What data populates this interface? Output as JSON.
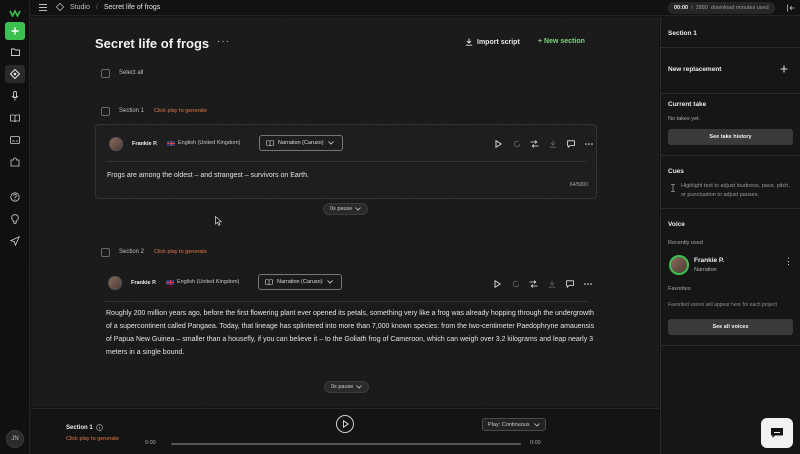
{
  "breadcrumb": {
    "app": "Studio",
    "project": "Secret life of frogs"
  },
  "usage": {
    "used": "00:00",
    "total": "2880",
    "suffix": "download minutes used"
  },
  "rail": {
    "user_initials": "JN"
  },
  "project": {
    "title": "Secret life of frogs",
    "import_label": "Import script",
    "new_section_label": "+ New section",
    "select_all_label": "Select all"
  },
  "sections": [
    {
      "label": "Section 1",
      "status": "Click play to generate",
      "voice": "Frankie P.",
      "language": "English (United Kingdom)",
      "model": "Narration (Caruso)",
      "text": "Frogs are among the oldest – and strangest – survivors on Earth.",
      "char_count": "64/5000",
      "pause": "0s pause"
    },
    {
      "label": "Section 2",
      "status": "Click play to generate",
      "voice": "Frankie P.",
      "language": "English (United Kingdom)",
      "model": "Narration (Caruso)",
      "text": "Roughly 200 million years ago, before the first flowering plant ever opened its petals, something very like a frog was already hopping through the undergrowth of a supercontinent called Pangaea. Today, that lineage has splintered into more than 7,000 known species: from the two-centimeter Paedophryne amauensis of Papua New Guinea – smaller than a housefly, if you can believe it – to the Goliath frog of Cameroon, which can weigh over 3.2 kilograms and leap nearly 3 meters in a single bound.",
      "pause": "0s pause"
    }
  ],
  "player": {
    "section": "Section 1",
    "status": "Click play to generate",
    "mode": "Play: Continuous",
    "time_start": "0:00",
    "time_end": "0:00"
  },
  "panel": {
    "title": "Section 1",
    "new_replacement": "New replacement",
    "current_take": "Current take",
    "no_takes": "No takes yet.",
    "see_take_history": "See take history",
    "cues": "Cues",
    "cues_hint": "Highlight text to adjust loudness, pace, pitch, or punctuation to adjust pauses.",
    "voice": "Voice",
    "recently_used": "Recently used",
    "recent_voice_name": "Frankie P.",
    "recent_voice_type": "Narration",
    "favorites": "Favorites",
    "favorites_hint": "Favorited voices will appear here for each project",
    "see_all_voices": "See all voices"
  },
  "colors": {
    "accent": "#3cc04f",
    "warning": "#e07a4b",
    "background": "#191919"
  }
}
